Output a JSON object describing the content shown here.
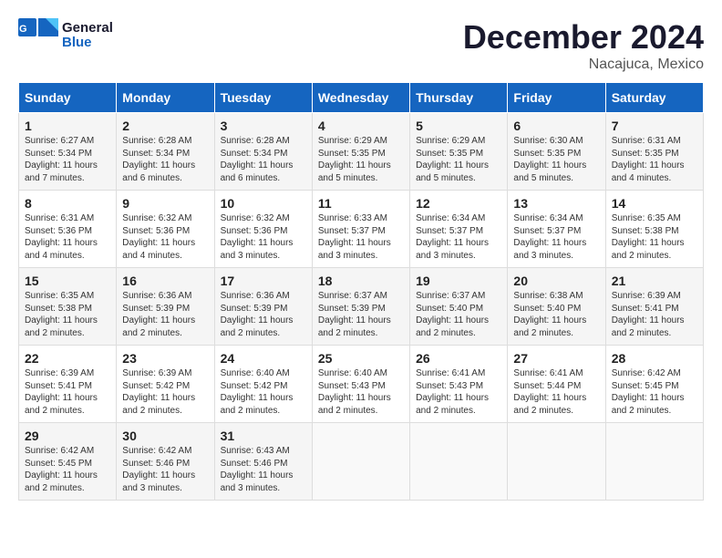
{
  "header": {
    "logo_line1": "General",
    "logo_line2": "Blue",
    "month_title": "December 2024",
    "location": "Nacajuca, Mexico"
  },
  "days_of_week": [
    "Sunday",
    "Monday",
    "Tuesday",
    "Wednesday",
    "Thursday",
    "Friday",
    "Saturday"
  ],
  "weeks": [
    [
      {
        "day": "1",
        "sunrise": "6:27 AM",
        "sunset": "5:34 PM",
        "daylight": "11 hours and 7 minutes."
      },
      {
        "day": "2",
        "sunrise": "6:28 AM",
        "sunset": "5:34 PM",
        "daylight": "11 hours and 6 minutes."
      },
      {
        "day": "3",
        "sunrise": "6:28 AM",
        "sunset": "5:34 PM",
        "daylight": "11 hours and 6 minutes."
      },
      {
        "day": "4",
        "sunrise": "6:29 AM",
        "sunset": "5:35 PM",
        "daylight": "11 hours and 5 minutes."
      },
      {
        "day": "5",
        "sunrise": "6:29 AM",
        "sunset": "5:35 PM",
        "daylight": "11 hours and 5 minutes."
      },
      {
        "day": "6",
        "sunrise": "6:30 AM",
        "sunset": "5:35 PM",
        "daylight": "11 hours and 5 minutes."
      },
      {
        "day": "7",
        "sunrise": "6:31 AM",
        "sunset": "5:35 PM",
        "daylight": "11 hours and 4 minutes."
      }
    ],
    [
      {
        "day": "8",
        "sunrise": "6:31 AM",
        "sunset": "5:36 PM",
        "daylight": "11 hours and 4 minutes."
      },
      {
        "day": "9",
        "sunrise": "6:32 AM",
        "sunset": "5:36 PM",
        "daylight": "11 hours and 4 minutes."
      },
      {
        "day": "10",
        "sunrise": "6:32 AM",
        "sunset": "5:36 PM",
        "daylight": "11 hours and 3 minutes."
      },
      {
        "day": "11",
        "sunrise": "6:33 AM",
        "sunset": "5:37 PM",
        "daylight": "11 hours and 3 minutes."
      },
      {
        "day": "12",
        "sunrise": "6:34 AM",
        "sunset": "5:37 PM",
        "daylight": "11 hours and 3 minutes."
      },
      {
        "day": "13",
        "sunrise": "6:34 AM",
        "sunset": "5:37 PM",
        "daylight": "11 hours and 3 minutes."
      },
      {
        "day": "14",
        "sunrise": "6:35 AM",
        "sunset": "5:38 PM",
        "daylight": "11 hours and 2 minutes."
      }
    ],
    [
      {
        "day": "15",
        "sunrise": "6:35 AM",
        "sunset": "5:38 PM",
        "daylight": "11 hours and 2 minutes."
      },
      {
        "day": "16",
        "sunrise": "6:36 AM",
        "sunset": "5:39 PM",
        "daylight": "11 hours and 2 minutes."
      },
      {
        "day": "17",
        "sunrise": "6:36 AM",
        "sunset": "5:39 PM",
        "daylight": "11 hours and 2 minutes."
      },
      {
        "day": "18",
        "sunrise": "6:37 AM",
        "sunset": "5:39 PM",
        "daylight": "11 hours and 2 minutes."
      },
      {
        "day": "19",
        "sunrise": "6:37 AM",
        "sunset": "5:40 PM",
        "daylight": "11 hours and 2 minutes."
      },
      {
        "day": "20",
        "sunrise": "6:38 AM",
        "sunset": "5:40 PM",
        "daylight": "11 hours and 2 minutes."
      },
      {
        "day": "21",
        "sunrise": "6:39 AM",
        "sunset": "5:41 PM",
        "daylight": "11 hours and 2 minutes."
      }
    ],
    [
      {
        "day": "22",
        "sunrise": "6:39 AM",
        "sunset": "5:41 PM",
        "daylight": "11 hours and 2 minutes."
      },
      {
        "day": "23",
        "sunrise": "6:39 AM",
        "sunset": "5:42 PM",
        "daylight": "11 hours and 2 minutes."
      },
      {
        "day": "24",
        "sunrise": "6:40 AM",
        "sunset": "5:42 PM",
        "daylight": "11 hours and 2 minutes."
      },
      {
        "day": "25",
        "sunrise": "6:40 AM",
        "sunset": "5:43 PM",
        "daylight": "11 hours and 2 minutes."
      },
      {
        "day": "26",
        "sunrise": "6:41 AM",
        "sunset": "5:43 PM",
        "daylight": "11 hours and 2 minutes."
      },
      {
        "day": "27",
        "sunrise": "6:41 AM",
        "sunset": "5:44 PM",
        "daylight": "11 hours and 2 minutes."
      },
      {
        "day": "28",
        "sunrise": "6:42 AM",
        "sunset": "5:45 PM",
        "daylight": "11 hours and 2 minutes."
      }
    ],
    [
      {
        "day": "29",
        "sunrise": "6:42 AM",
        "sunset": "5:45 PM",
        "daylight": "11 hours and 2 minutes."
      },
      {
        "day": "30",
        "sunrise": "6:42 AM",
        "sunset": "5:46 PM",
        "daylight": "11 hours and 3 minutes."
      },
      {
        "day": "31",
        "sunrise": "6:43 AM",
        "sunset": "5:46 PM",
        "daylight": "11 hours and 3 minutes."
      },
      null,
      null,
      null,
      null
    ]
  ]
}
